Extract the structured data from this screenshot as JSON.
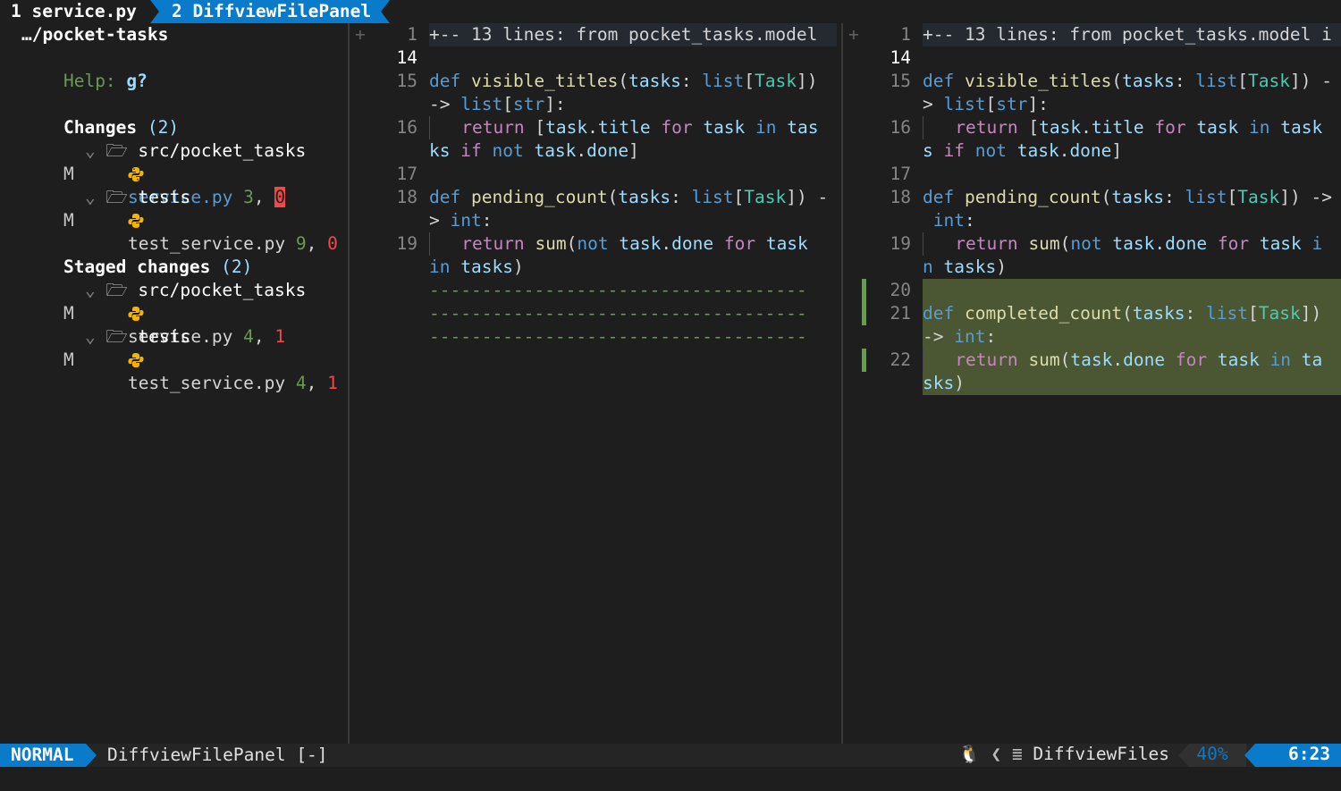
{
  "tabline": {
    "tab1": "1 service.py",
    "tab2": "2 DiffviewFilePanel"
  },
  "filepanel": {
    "root": "…/pocket-tasks",
    "help_label": "Help:",
    "help_key": "g?",
    "changes": {
      "title": "Changes",
      "count": "(2)",
      "folders": [
        {
          "name": "src/pocket_tasks",
          "file": {
            "status": "M",
            "name": "service.py",
            "added": "3",
            "removed": "0"
          }
        },
        {
          "name": "tests",
          "file": {
            "status": "M",
            "name": "test_service.py",
            "added": "9",
            "removed": "0"
          }
        }
      ]
    },
    "staged": {
      "title": "Staged changes",
      "count": "(2)",
      "folders": [
        {
          "name": "src/pocket_tasks",
          "file": {
            "status": "M",
            "name": "service.py",
            "added": "4",
            "removed": "1"
          }
        },
        {
          "name": "tests",
          "file": {
            "status": "M",
            "name": "test_service.py",
            "added": "4",
            "removed": "1"
          }
        }
      ]
    }
  },
  "left": {
    "fold": "+-- 13 lines: from pocket_tasks.model ",
    "lnums": [
      "1",
      "14",
      "15",
      "",
      "16",
      "",
      "17",
      "18",
      "",
      "19",
      ""
    ],
    "filler": "------------------------------------"
  },
  "right": {
    "fold": "+-- 13 lines: from pocket_tasks.model i",
    "lnums": [
      "1",
      "14",
      "15",
      "",
      "16",
      "",
      "17",
      "18",
      "",
      "19",
      "",
      "20",
      "21",
      "",
      "22",
      ""
    ]
  },
  "statusline": {
    "mode": "NORMAL",
    "file": "DiffviewFilePanel [-]",
    "filetype": "DiffviewFiles",
    "percent": "40%",
    "position": "6:23"
  },
  "colors": {
    "accent": "#0a7aca",
    "added_bg": "#4b5632",
    "added": "#6a9955",
    "removed": "#f44747"
  }
}
